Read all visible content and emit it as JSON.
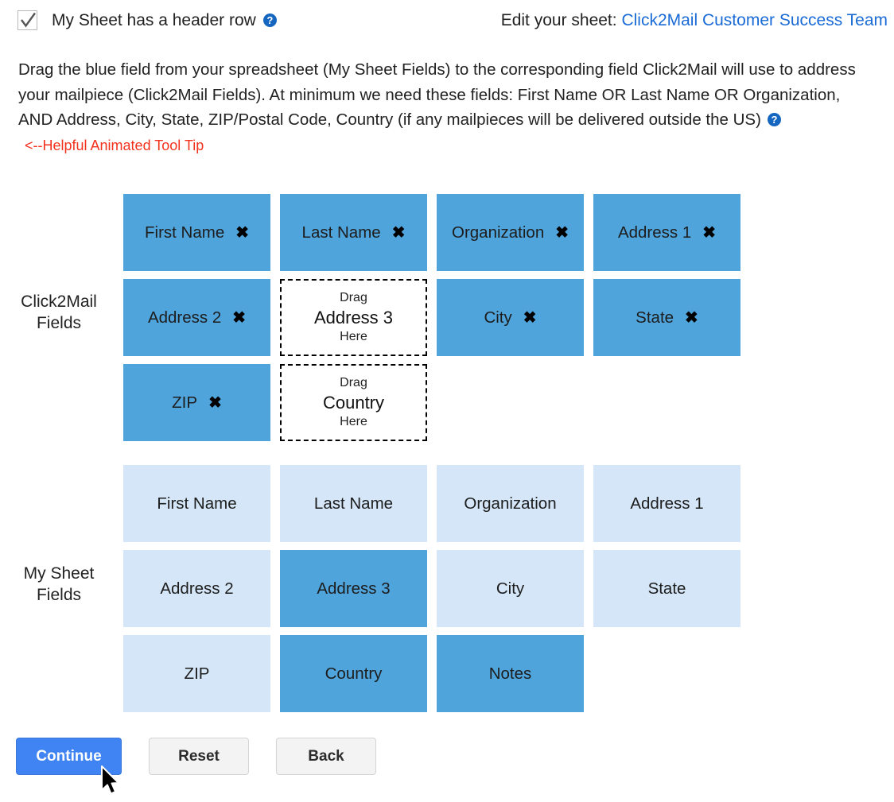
{
  "header": {
    "checkbox_label": "My Sheet has a header row",
    "checkbox_checked": true,
    "help_icon": "question-mark-help-icon",
    "edit_prefix": "Edit your sheet:",
    "sheet_name": "Click2Mail Customer Success Team",
    "link_color": "#1a6bd6"
  },
  "instructions": {
    "text": "Drag the blue field from your spreadsheet (My Sheet Fields) to the corresponding field Click2Mail will use to address your mailpiece (Click2Mail Fields). At minimum we need these fields: First Name OR Last Name OR Organization, AND Address, City, State, ZIP/Postal Code, Country (if any mailpieces will be delivered outside the US)",
    "tooltip_note": "<--Helpful Animated Tool Tip",
    "tooltip_note_color": "#f3321e",
    "help_icon": "question-mark-help-icon"
  },
  "click2mail_fields": {
    "label": "Click2Mail\nFields",
    "label_line1": "Click2Mail",
    "label_line2": "Fields",
    "filled_color": "#4fa4dc",
    "remove_glyph": "✖",
    "drop_pre": "Drag",
    "drop_post": "Here",
    "rows": [
      [
        {
          "name": "First Name",
          "state": "filled"
        },
        {
          "name": "Last Name",
          "state": "filled"
        },
        {
          "name": "Organization",
          "state": "filled"
        },
        {
          "name": "Address 1",
          "state": "filled"
        }
      ],
      [
        {
          "name": "Address 2",
          "state": "filled"
        },
        {
          "name": "Address 3",
          "state": "empty"
        },
        {
          "name": "City",
          "state": "filled"
        },
        {
          "name": "State",
          "state": "filled"
        }
      ],
      [
        {
          "name": "ZIP",
          "state": "filled"
        },
        {
          "name": "Country",
          "state": "empty"
        },
        {
          "name": "",
          "state": "spacer"
        },
        {
          "name": "",
          "state": "spacer"
        }
      ]
    ]
  },
  "my_sheet_fields": {
    "label_line1": "My Sheet",
    "label_line2": "Fields",
    "used_color": "#d4e6f7",
    "available_color": "#4fa4dc",
    "rows": [
      [
        {
          "name": "First Name",
          "state": "used"
        },
        {
          "name": "Last Name",
          "state": "used"
        },
        {
          "name": "Organization",
          "state": "used"
        },
        {
          "name": "Address 1",
          "state": "used"
        }
      ],
      [
        {
          "name": "Address 2",
          "state": "used"
        },
        {
          "name": "Address 3",
          "state": "available"
        },
        {
          "name": "City",
          "state": "used"
        },
        {
          "name": "State",
          "state": "used"
        }
      ],
      [
        {
          "name": "ZIP",
          "state": "used"
        },
        {
          "name": "Country",
          "state": "available"
        },
        {
          "name": "Notes",
          "state": "available"
        },
        {
          "name": "",
          "state": "spacer"
        }
      ]
    ]
  },
  "buttons": {
    "continue": "Continue",
    "reset": "Reset",
    "back": "Back",
    "primary_color": "#4083f2"
  },
  "cursor": {
    "type": "arrow-pointer"
  }
}
